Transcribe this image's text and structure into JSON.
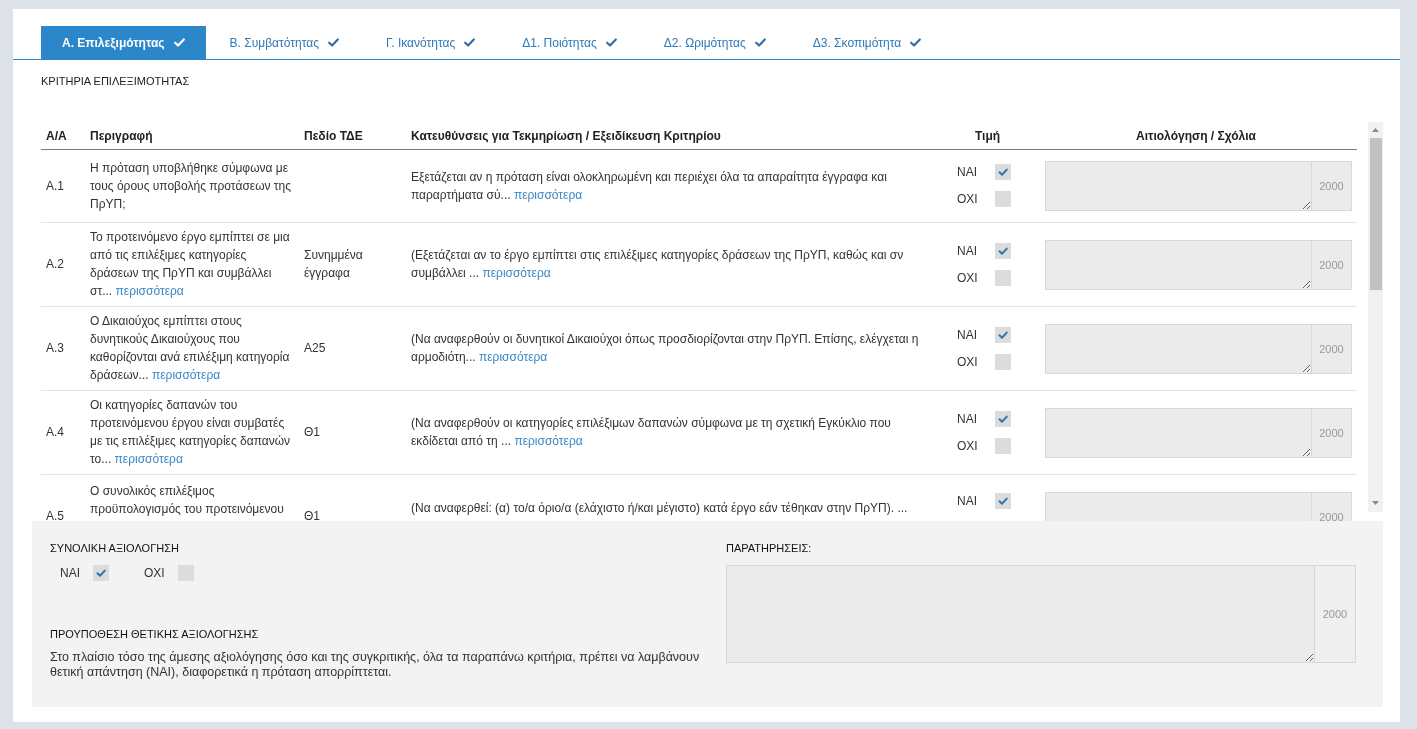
{
  "tabs": [
    {
      "label": "Α. Επιλεξιμότητας",
      "selected": true,
      "completed": true
    },
    {
      "label": "Β. Συμβατότητας",
      "selected": false,
      "completed": true
    },
    {
      "label": "Γ. Ικανότητας",
      "selected": false,
      "completed": true
    },
    {
      "label": "Δ1. Ποιότητας",
      "selected": false,
      "completed": true
    },
    {
      "label": "Δ2. Ωριμότητας",
      "selected": false,
      "completed": true
    },
    {
      "label": "Δ3. Σκοπιμότητα",
      "selected": false,
      "completed": true
    }
  ],
  "section_title": "ΚΡΙΤΗΡΙΑ ΕΠΙΛΕΞΙΜΟΤΗΤΑΣ",
  "table": {
    "columns": [
      "Α/Α",
      "Περιγραφή",
      "Πεδίο ΤΔΕ",
      "Κατευθύνσεις για Τεκμηρίωση / Εξειδίκευση Κριτηρίου",
      "Τιμή",
      "Αιτιολόγηση / Σχόλια"
    ],
    "rows": [
      {
        "code": "Α.1",
        "description": {
          "text": "Η πρόταση υποβλήθηκε σύμφωνα με τους όρους υποβολής προτάσεων της ΠρΥΠ;"
        },
        "guideline": {
          "text": "Εξετάζεται αν η πρόταση είναι ολοκληρωμένη και περιέχει όλα τα απαραίτητα έγγραφα και παραρτήματα σύ...",
          "more": "περισσότερα"
        },
        "options": [
          {
            "label": "ΝΑΙ",
            "checked": true
          },
          {
            "label": "ΟΧΙ",
            "checked": false
          }
        ],
        "comment": {
          "counter": "2000"
        }
      },
      {
        "code": "Α.2",
        "description": {
          "text": "Το προτεινόμενο έργο εμπίπτει σε μια από τις επιλέξιμες κατηγορίες δράσεων της ΠρΥΠ και συμβάλλει στ...",
          "more": "περισσότερα"
        },
        "tde_field": "Συνημμένα έγγραφα",
        "guideline": {
          "text": "(Εξετάζεται αν το έργο εμπίπτει στις επιλέξιμες κατηγορίες δράσεων της ΠρΥΠ, καθώς και σν συμβάλλει ...",
          "more": "περισσότερα"
        },
        "options": [
          {
            "label": "ΝΑΙ",
            "checked": true
          },
          {
            "label": "ΟΧΙ",
            "checked": false
          }
        ],
        "comment": {
          "counter": "2000"
        }
      },
      {
        "code": "Α.3",
        "description": {
          "text": "Ο Δικαιούχος εμπίπτει στους δυνητικούς Δικαιούχους που καθορίζονται ανά επιλέξιμη κατηγορία δράσεων...",
          "more": "περισσότερα"
        },
        "tde_field": "Α25",
        "guideline": {
          "text": "(Να αναφερθούν οι δυνητικοί Δικαιούχοι όπως προσδιορίζονται στην ΠρΥΠ. Επίσης, ελέγχεται η αρμοδιότη...",
          "more": "περισσότερα"
        },
        "options": [
          {
            "label": "ΝΑΙ",
            "checked": true
          },
          {
            "label": "ΟΧΙ",
            "checked": false
          }
        ],
        "comment": {
          "counter": "2000"
        }
      },
      {
        "code": "Α.4",
        "description": {
          "text": "Οι κατηγορίες δαπανών του προτεινόμενου έργου είναι συμβατές με τις επιλέξιμες κατηγορίες δαπανών το...",
          "more": "περισσότερα"
        },
        "tde_field": "Θ1",
        "guideline": {
          "text": "(Να αναφερθούν οι κατηγορίες επιλέξιμων δαπανών σύμφωνα με τη σχετική Εγκύκλιο που εκδίδεται από τη ...",
          "more": "περισσότερα"
        },
        "options": [
          {
            "label": "ΝΑΙ",
            "checked": true
          },
          {
            "label": "ΟΧΙ",
            "checked": false
          }
        ],
        "comment": {
          "counter": "2000"
        }
      },
      {
        "code": "Α.5",
        "description": {
          "text": "Ο συνολικός επιλέξιμος προϋπολογισμός του προτεινόμενου"
        },
        "tde_field": "Θ1",
        "guideline": {
          "text": "(Να αναφερθεί: (α) το/α όριο/α (ελάχιστο ή/και μέγιστο) κατά έργο εάν τέθηκαν στην ΠρΥΠ). ..."
        },
        "options": [
          {
            "label": "ΝΑΙ",
            "checked": true
          }
        ],
        "comment": {
          "counter": "2000"
        }
      }
    ]
  },
  "overall_assessment": {
    "title": "ΣΥΝΟΛΙΚΗ ΑΞΙΟΛΟΓΗΣΗ",
    "options": [
      {
        "label": "ΝΑΙ",
        "checked": true
      },
      {
        "label": "ΟΧΙ",
        "checked": false
      }
    ]
  },
  "precondition": {
    "title": "ΠΡΟΥΠΟΘΕΣΗ ΘΕΤΙΚΗΣ ΑΞΙΟΛΟΓΗΣΗΣ",
    "text": "Στο πλαίσιο τόσο της άμεσης αξιολόγησης όσο και της συγκριτικής, όλα τα παραπάνω κριτήρια, πρέπει να λαμβάνουν θετική απάντηση (ΝΑΙ), διαφορετικά η πρόταση απορρίπτεται."
  },
  "remarks": {
    "label": "ΠΑΡΑΤΗΡΗΣΕΙΣ:",
    "counter": "2000"
  }
}
